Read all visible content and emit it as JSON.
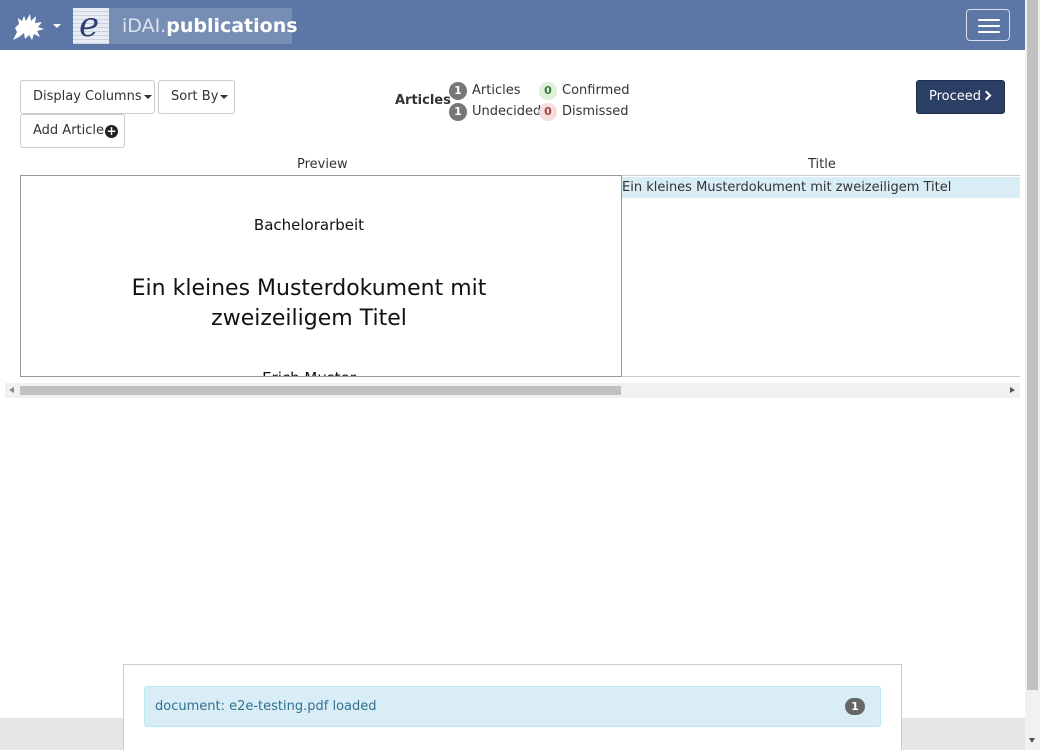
{
  "brand": {
    "name_light": "iDAI.",
    "name_bold": "publications",
    "logo_letter": "e",
    "logo_icon": "griffin-logo-icon",
    "colors": {
      "navbar": "#5c77a5",
      "proceed": "#2a3f63"
    }
  },
  "toolbar": {
    "display_columns_label": "Display Columns",
    "sort_by_label": "Sort By",
    "add_article_label": "Add Article",
    "proceed_label": "Proceed"
  },
  "stats": {
    "title": "Articles",
    "articles": {
      "count": "1",
      "label": "Articles"
    },
    "undecided": {
      "count": "1",
      "label": "Undecided"
    },
    "confirmed": {
      "count": "0",
      "label": "Confirmed"
    },
    "dismissed": {
      "count": "0",
      "label": "Dismissed"
    }
  },
  "table": {
    "columns": [
      "Preview",
      "Title"
    ],
    "preview": {
      "thesis_type": "Bachelorarbeit",
      "title_line1": "Ein kleines Musterdokument mit",
      "title_line2": "zweizeiligem Titel",
      "author": "Erich Muster"
    },
    "rows": [
      {
        "title": "Ein kleines Musterdokument mit zweizeiligem Titel"
      }
    ]
  },
  "messages": [
    {
      "text": "document: e2e-testing.pdf loaded",
      "count": "1"
    }
  ]
}
